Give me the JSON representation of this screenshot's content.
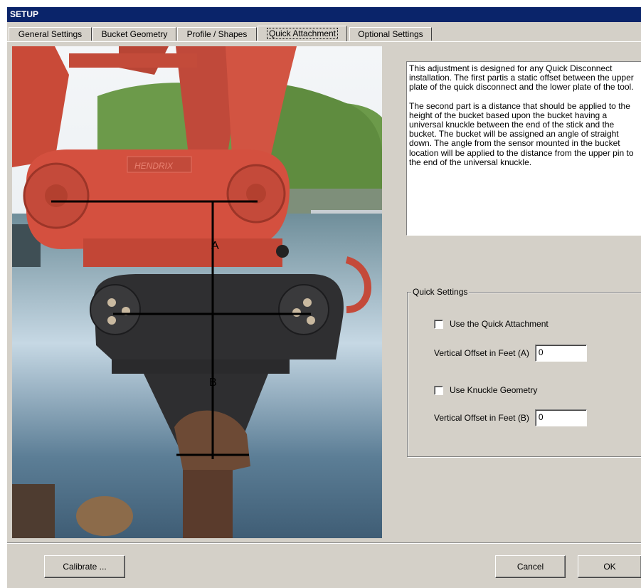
{
  "window": {
    "title": "SETUP"
  },
  "tabs": [
    {
      "label": "General Settings"
    },
    {
      "label": "Bucket Geometry"
    },
    {
      "label": "Profile / Shapes"
    },
    {
      "label": "Quick Attachment"
    },
    {
      "label": "Optional Settings"
    }
  ],
  "active_tab": "Quick Attachment",
  "photo": {
    "label_a": "A",
    "label_b": "B",
    "brand": "HENDRIX"
  },
  "description": {
    "p1": "This adjustment is designed for any Quick Disconnect installation. The first partis a static offset between the upper plate of the quick disconnect and the lower plate of the tool.",
    "p2": "The second part is a distance that should be applied to the height of the bucket based upon the bucket having a universal knuckle between the end of the stick and the bucket. The bucket will be assigned an angle of straight down. The angle from the sensor mounted in the bucket location will be applied to the distance from the upper pin to the end of the universal knuckle."
  },
  "quick_settings": {
    "legend": "Quick Settings",
    "use_quick_label": "Use the Quick Attachment",
    "use_quick_checked": false,
    "offset_a_label": "Vertical Offset in Feet  (A)",
    "offset_a_value": "0",
    "use_knuckle_label": "Use Knuckle Geometry",
    "use_knuckle_checked": false,
    "offset_b_label": "Vertical Offset in Feet  (B)",
    "offset_b_value": "0"
  },
  "buttons": {
    "calibrate": "Calibrate ...",
    "cancel": "Cancel",
    "ok": "OK"
  }
}
